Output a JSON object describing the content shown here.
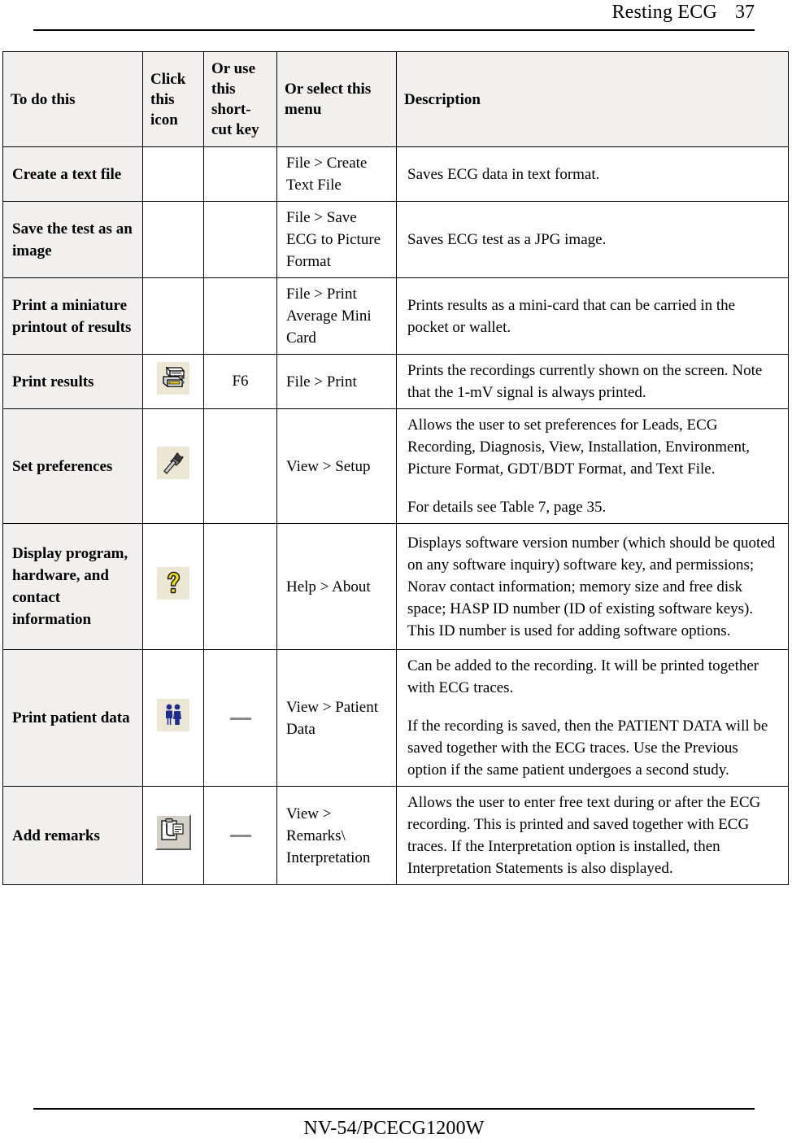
{
  "header": {
    "title": "Resting ECG",
    "page_number": "37"
  },
  "footer": {
    "text": "NV-54/PCECG1200W"
  },
  "table": {
    "columns": [
      {
        "key": "task",
        "label": "To do this"
      },
      {
        "key": "icon",
        "label": "Click this icon"
      },
      {
        "key": "shortcut",
        "label": "Or use this short-cut key"
      },
      {
        "key": "menu",
        "label": "Or select this menu"
      },
      {
        "key": "description",
        "label": "Description"
      }
    ],
    "rows": [
      {
        "task": "Create a text file",
        "icon": "",
        "shortcut": "",
        "menu": "File > Create Text File",
        "description_1": "Saves ECG data in text format.",
        "description_2": ""
      },
      {
        "task": "Save the test as an image",
        "icon": "",
        "shortcut": "",
        "menu": "File > Save ECG to Picture Format",
        "description_1": "Saves ECG test as a JPG image.",
        "description_2": ""
      },
      {
        "task": "Print a miniature printout of results",
        "icon": "",
        "shortcut": "",
        "menu": "File > Print Average Mini Card",
        "description_1": "Prints results as a mini-card that can be carried in the pocket or wallet.",
        "description_2": ""
      },
      {
        "task": "Print results",
        "icon": "printer-icon",
        "shortcut": "F6",
        "menu": "File > Print",
        "description_1": "Prints the recordings currently shown on the screen. Note that the 1-mV signal is always printed.",
        "description_2": ""
      },
      {
        "task": "Set preferences",
        "icon": "hammer-tool-icon",
        "shortcut": "",
        "menu": "View > Setup",
        "description_1": "Allows the user to set preferences for Leads, ECG Recording, Diagnosis, View, Installation, Environment, Picture Format, GDT/BDT Format, and Text File.",
        "description_2": "For details see Table 7, page 35."
      },
      {
        "task": "Display program, hardware, and contact information",
        "icon": "question-mark-help-icon",
        "shortcut": "",
        "menu": "Help > About",
        "description_1": "Displays software version number (which should be quoted on any software inquiry) software key, and permissions; Norav contact information; memory size and free disk space; HASP ID number (ID of existing software keys). This ID number is used for adding software options.",
        "description_2": ""
      },
      {
        "task": "Print patient data",
        "icon": "two-people-patient-icon",
        "shortcut": "—",
        "menu": "View > Patient Data",
        "description_1": "Can be added to the recording. It will be printed together with ECG traces.",
        "description_2": "If the recording is saved, then the PATIENT DATA will be saved together with the ECG traces. Use the Previous option if the same patient undergoes a second study."
      },
      {
        "task": "Add remarks",
        "icon": "clipboard-remarks-icon",
        "shortcut": "—",
        "menu": "View > Remarks\\ Interpretation",
        "description_1": "Allows the user to enter free text during or after the ECG recording. This is printed and saved together with ECG traces. If the Interpretation option is installed, then Interpretation Statements is also displayed.",
        "description_2": ""
      }
    ]
  },
  "colors": {
    "header_fill": "#f1f0ee",
    "icon_background": "#ece7d5",
    "button_face": "#d4d0c8",
    "help_icon_yellow": "#f2e000",
    "patient_icon_blue": "#1f2d92",
    "rule": "#000000"
  }
}
